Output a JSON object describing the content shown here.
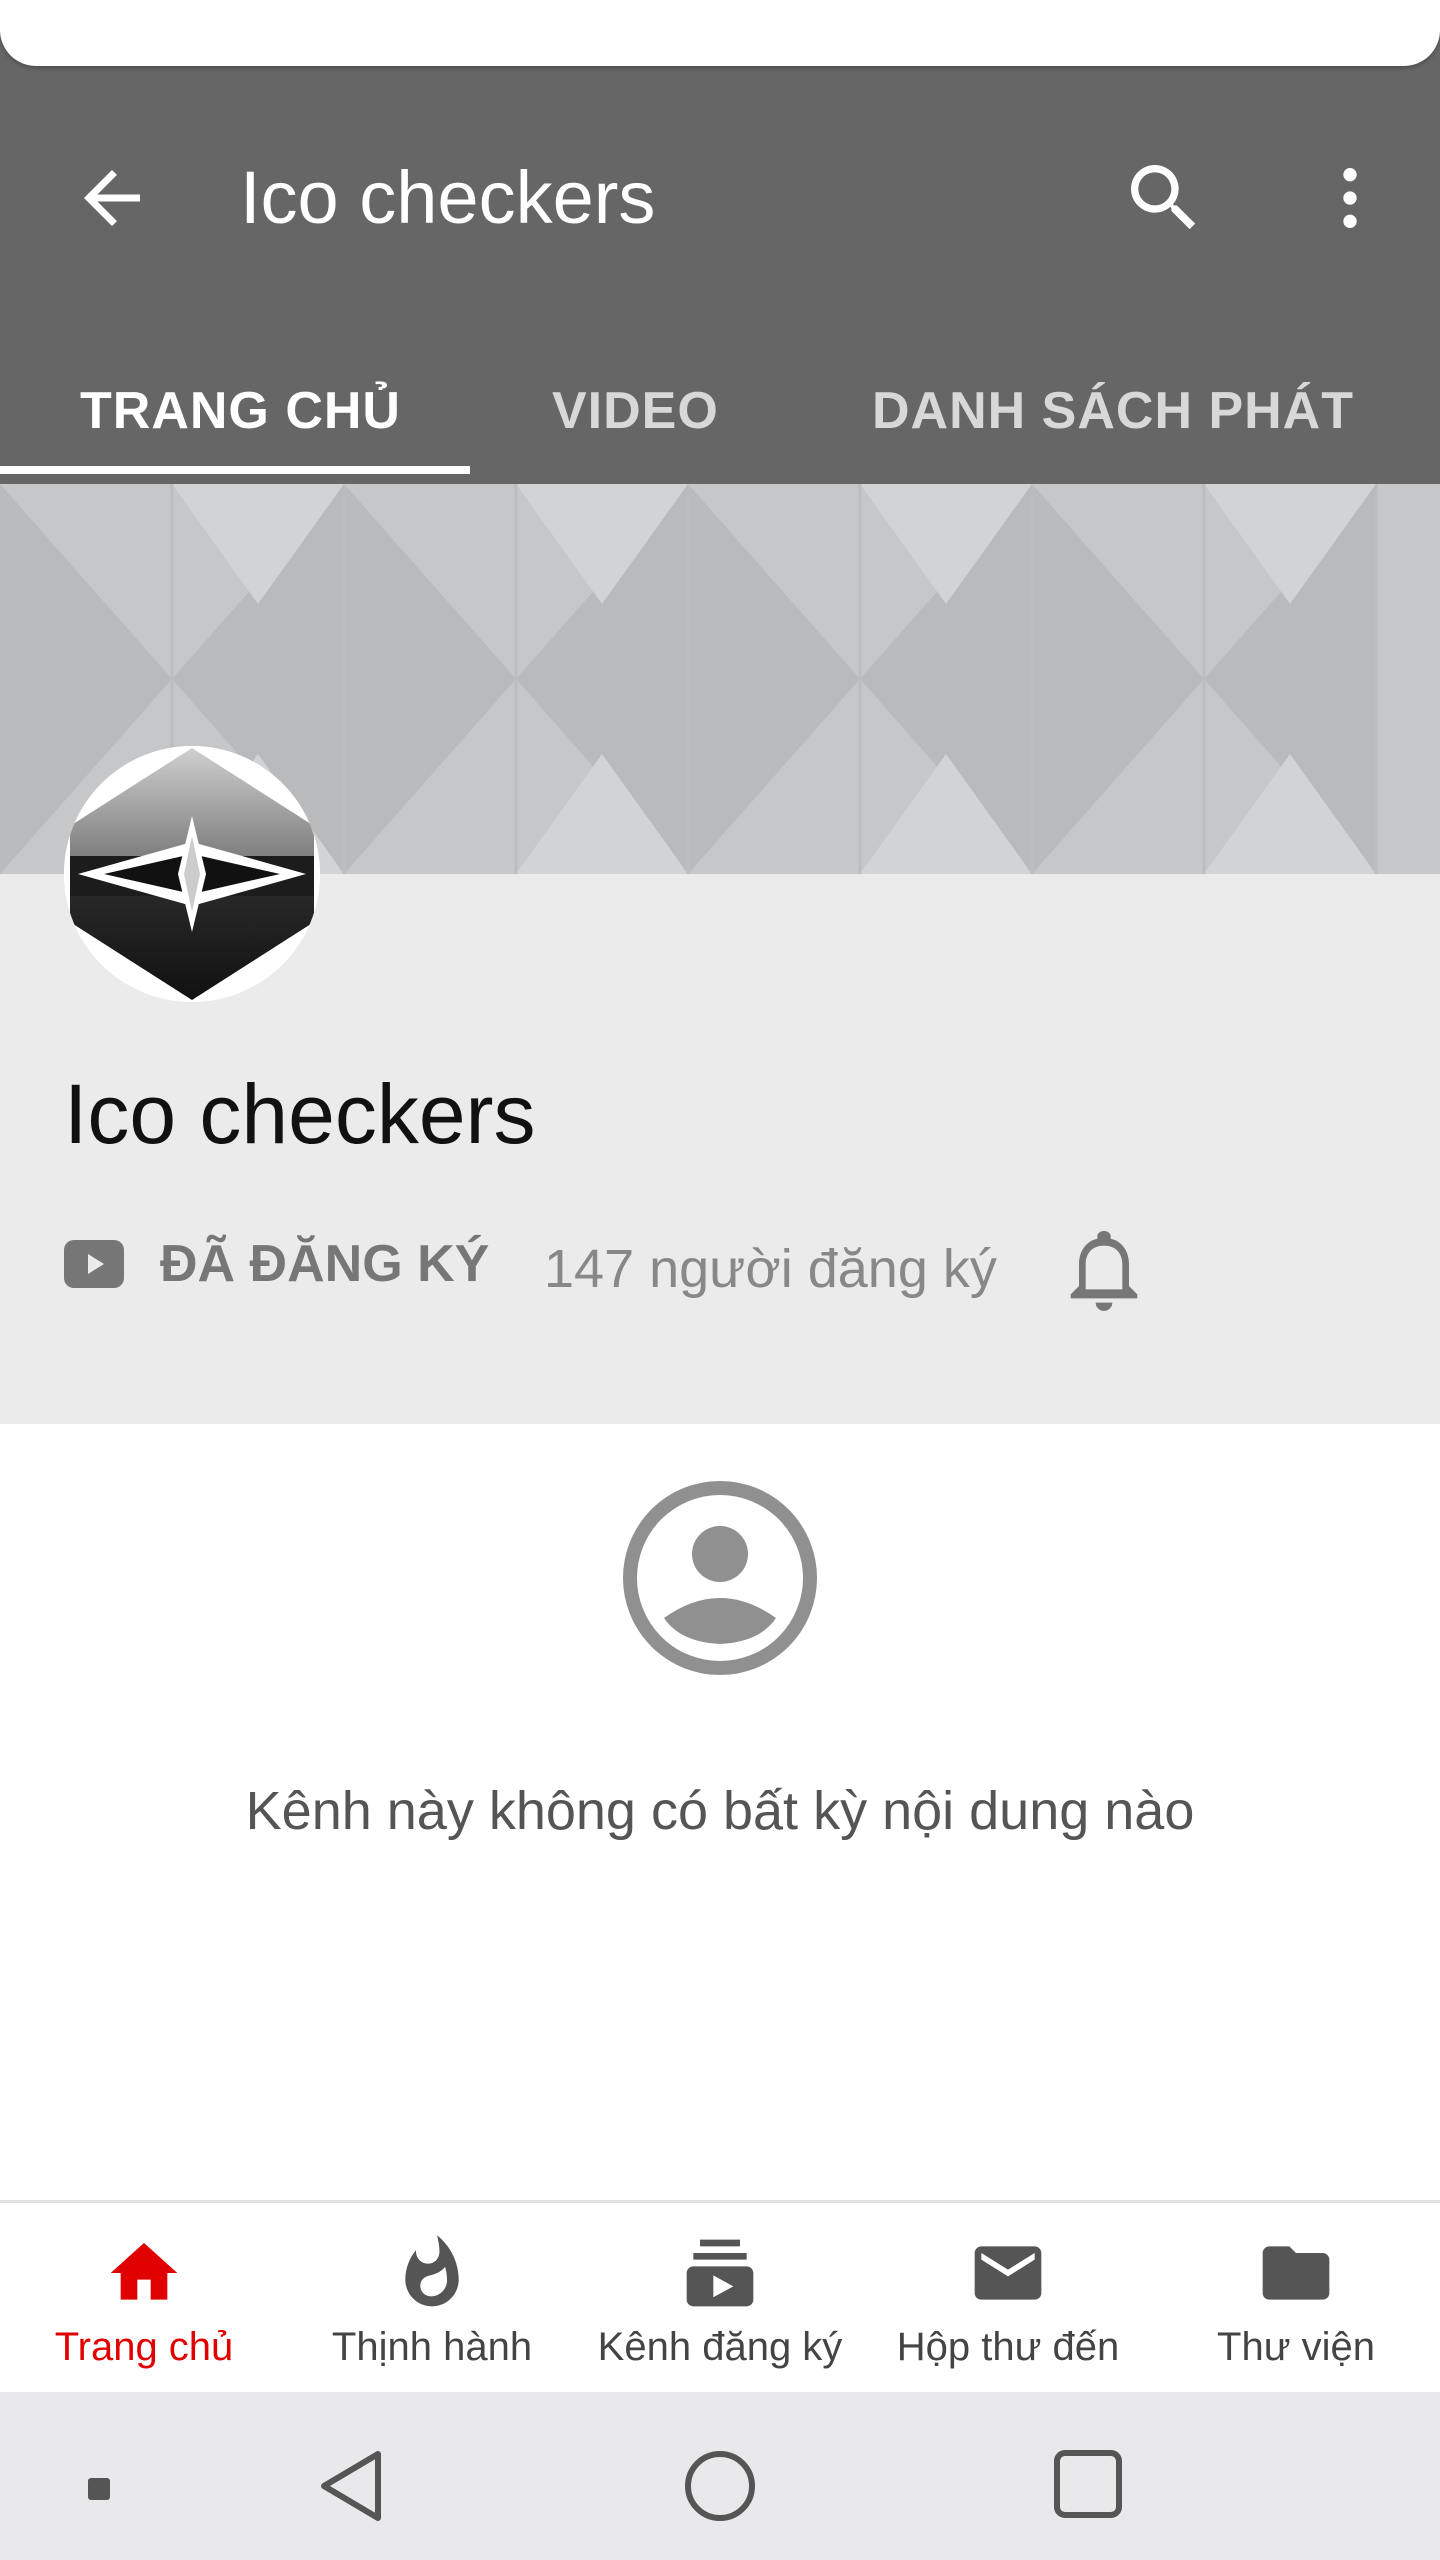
{
  "app_bar": {
    "title": "Ico checkers",
    "back_icon": "arrow-left-icon",
    "search_icon": "search-icon",
    "more_icon": "more-vertical-icon"
  },
  "tabs": [
    {
      "label": "TRANG CHỦ",
      "active": true
    },
    {
      "label": "VIDEO",
      "active": false
    },
    {
      "label": "DANH SÁCH PHÁT",
      "active": false
    }
  ],
  "channel": {
    "name": "Ico checkers",
    "subscribed_label": "ĐÃ ĐĂNG KÝ",
    "subscriber_count": "147 người đăng ký"
  },
  "empty_state": {
    "message": "Kênh này không có bất kỳ nội dung nào"
  },
  "bottom_nav": [
    {
      "label": "Trang chủ",
      "icon": "home-icon",
      "active": true
    },
    {
      "label": "Thịnh hành",
      "icon": "flame-icon",
      "active": false
    },
    {
      "label": "Kênh đăng ký",
      "icon": "subscriptions-icon",
      "active": false
    },
    {
      "label": "Hộp thư đến",
      "icon": "mail-icon",
      "active": false
    },
    {
      "label": "Thư viện",
      "icon": "folder-icon",
      "active": false
    }
  ],
  "colors": {
    "app_bar": "#666666",
    "accent_red": "#e00000",
    "info_bg": "#ebebeb"
  }
}
